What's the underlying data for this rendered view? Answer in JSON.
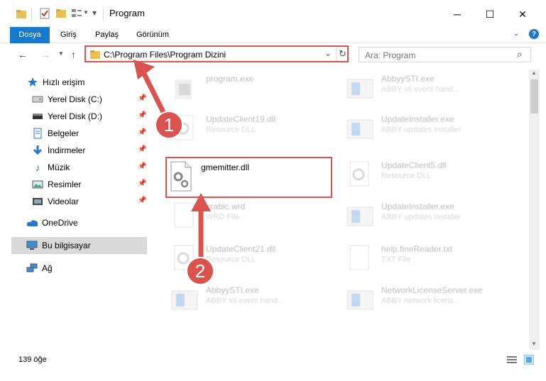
{
  "window": {
    "title": "Program",
    "minimize": "─",
    "maximize": "☐",
    "close": "✕"
  },
  "ribbon": {
    "tabs": [
      "Dosya",
      "Giriş",
      "Paylaş",
      "Görünüm"
    ],
    "help_glyph": "?"
  },
  "address": {
    "path": "C:\\Program Files\\Program Dizini",
    "search_placeholder": "Ara: Program"
  },
  "sidebar": {
    "items": [
      {
        "label": "Hızlı erişim",
        "icon": "star-icon"
      },
      {
        "label": "Yerel Disk (C:)",
        "icon": "drive-icon",
        "pinned": true
      },
      {
        "label": "Yerel Disk (D:)",
        "icon": "drive-icon",
        "pinned": true
      },
      {
        "label": "Belgeler",
        "icon": "documents-icon",
        "pinned": true
      },
      {
        "label": "İndirmeler",
        "icon": "download-icon",
        "pinned": true
      },
      {
        "label": "Müzik",
        "icon": "music-icon",
        "pinned": true
      },
      {
        "label": "Resimler",
        "icon": "pictures-icon",
        "pinned": true
      },
      {
        "label": "Videolar",
        "icon": "videos-icon",
        "pinned": true
      },
      {
        "label": "OneDrive",
        "icon": "cloud-icon"
      },
      {
        "label": "Bu bilgisayar",
        "icon": "computer-icon"
      },
      {
        "label": "Ağ",
        "icon": "network-icon"
      }
    ]
  },
  "files": [
    {
      "name": "program.exe",
      "type": ""
    },
    {
      "name": "AbbyySTI.exe",
      "type": "ABBY sti event hand..."
    },
    {
      "name": "UpdateClient19.dll",
      "type": "Resource DLL"
    },
    {
      "name": "UpdateInstaller.exe",
      "type": "ABBY updates installer"
    },
    {
      "name": "gmemitter.dll",
      "type": ""
    },
    {
      "name": "UpdateClient5.dll",
      "type": "Resource DLL"
    },
    {
      "name": "arabic.wrd",
      "type": "WRD File"
    },
    {
      "name": "UpdateInstaller.exe",
      "type": "ABBY updates installer"
    },
    {
      "name": "UpdateClient21.dll",
      "type": "Resource DLL"
    },
    {
      "name": "help.fineReader.txt",
      "type": "TXT File"
    },
    {
      "name": "AbbyySTI.exe",
      "type": "ABBY sti event hand..."
    },
    {
      "name": "NetworkLicenseServer.exe",
      "type": "ABBY network licens..."
    }
  ],
  "status": {
    "count": "139 öğe"
  },
  "annotations": {
    "step1": "1",
    "step2": "2"
  },
  "colors": {
    "accent": "#1979ca",
    "annotation": "#d9534f",
    "selected": "#d9d9d9"
  }
}
